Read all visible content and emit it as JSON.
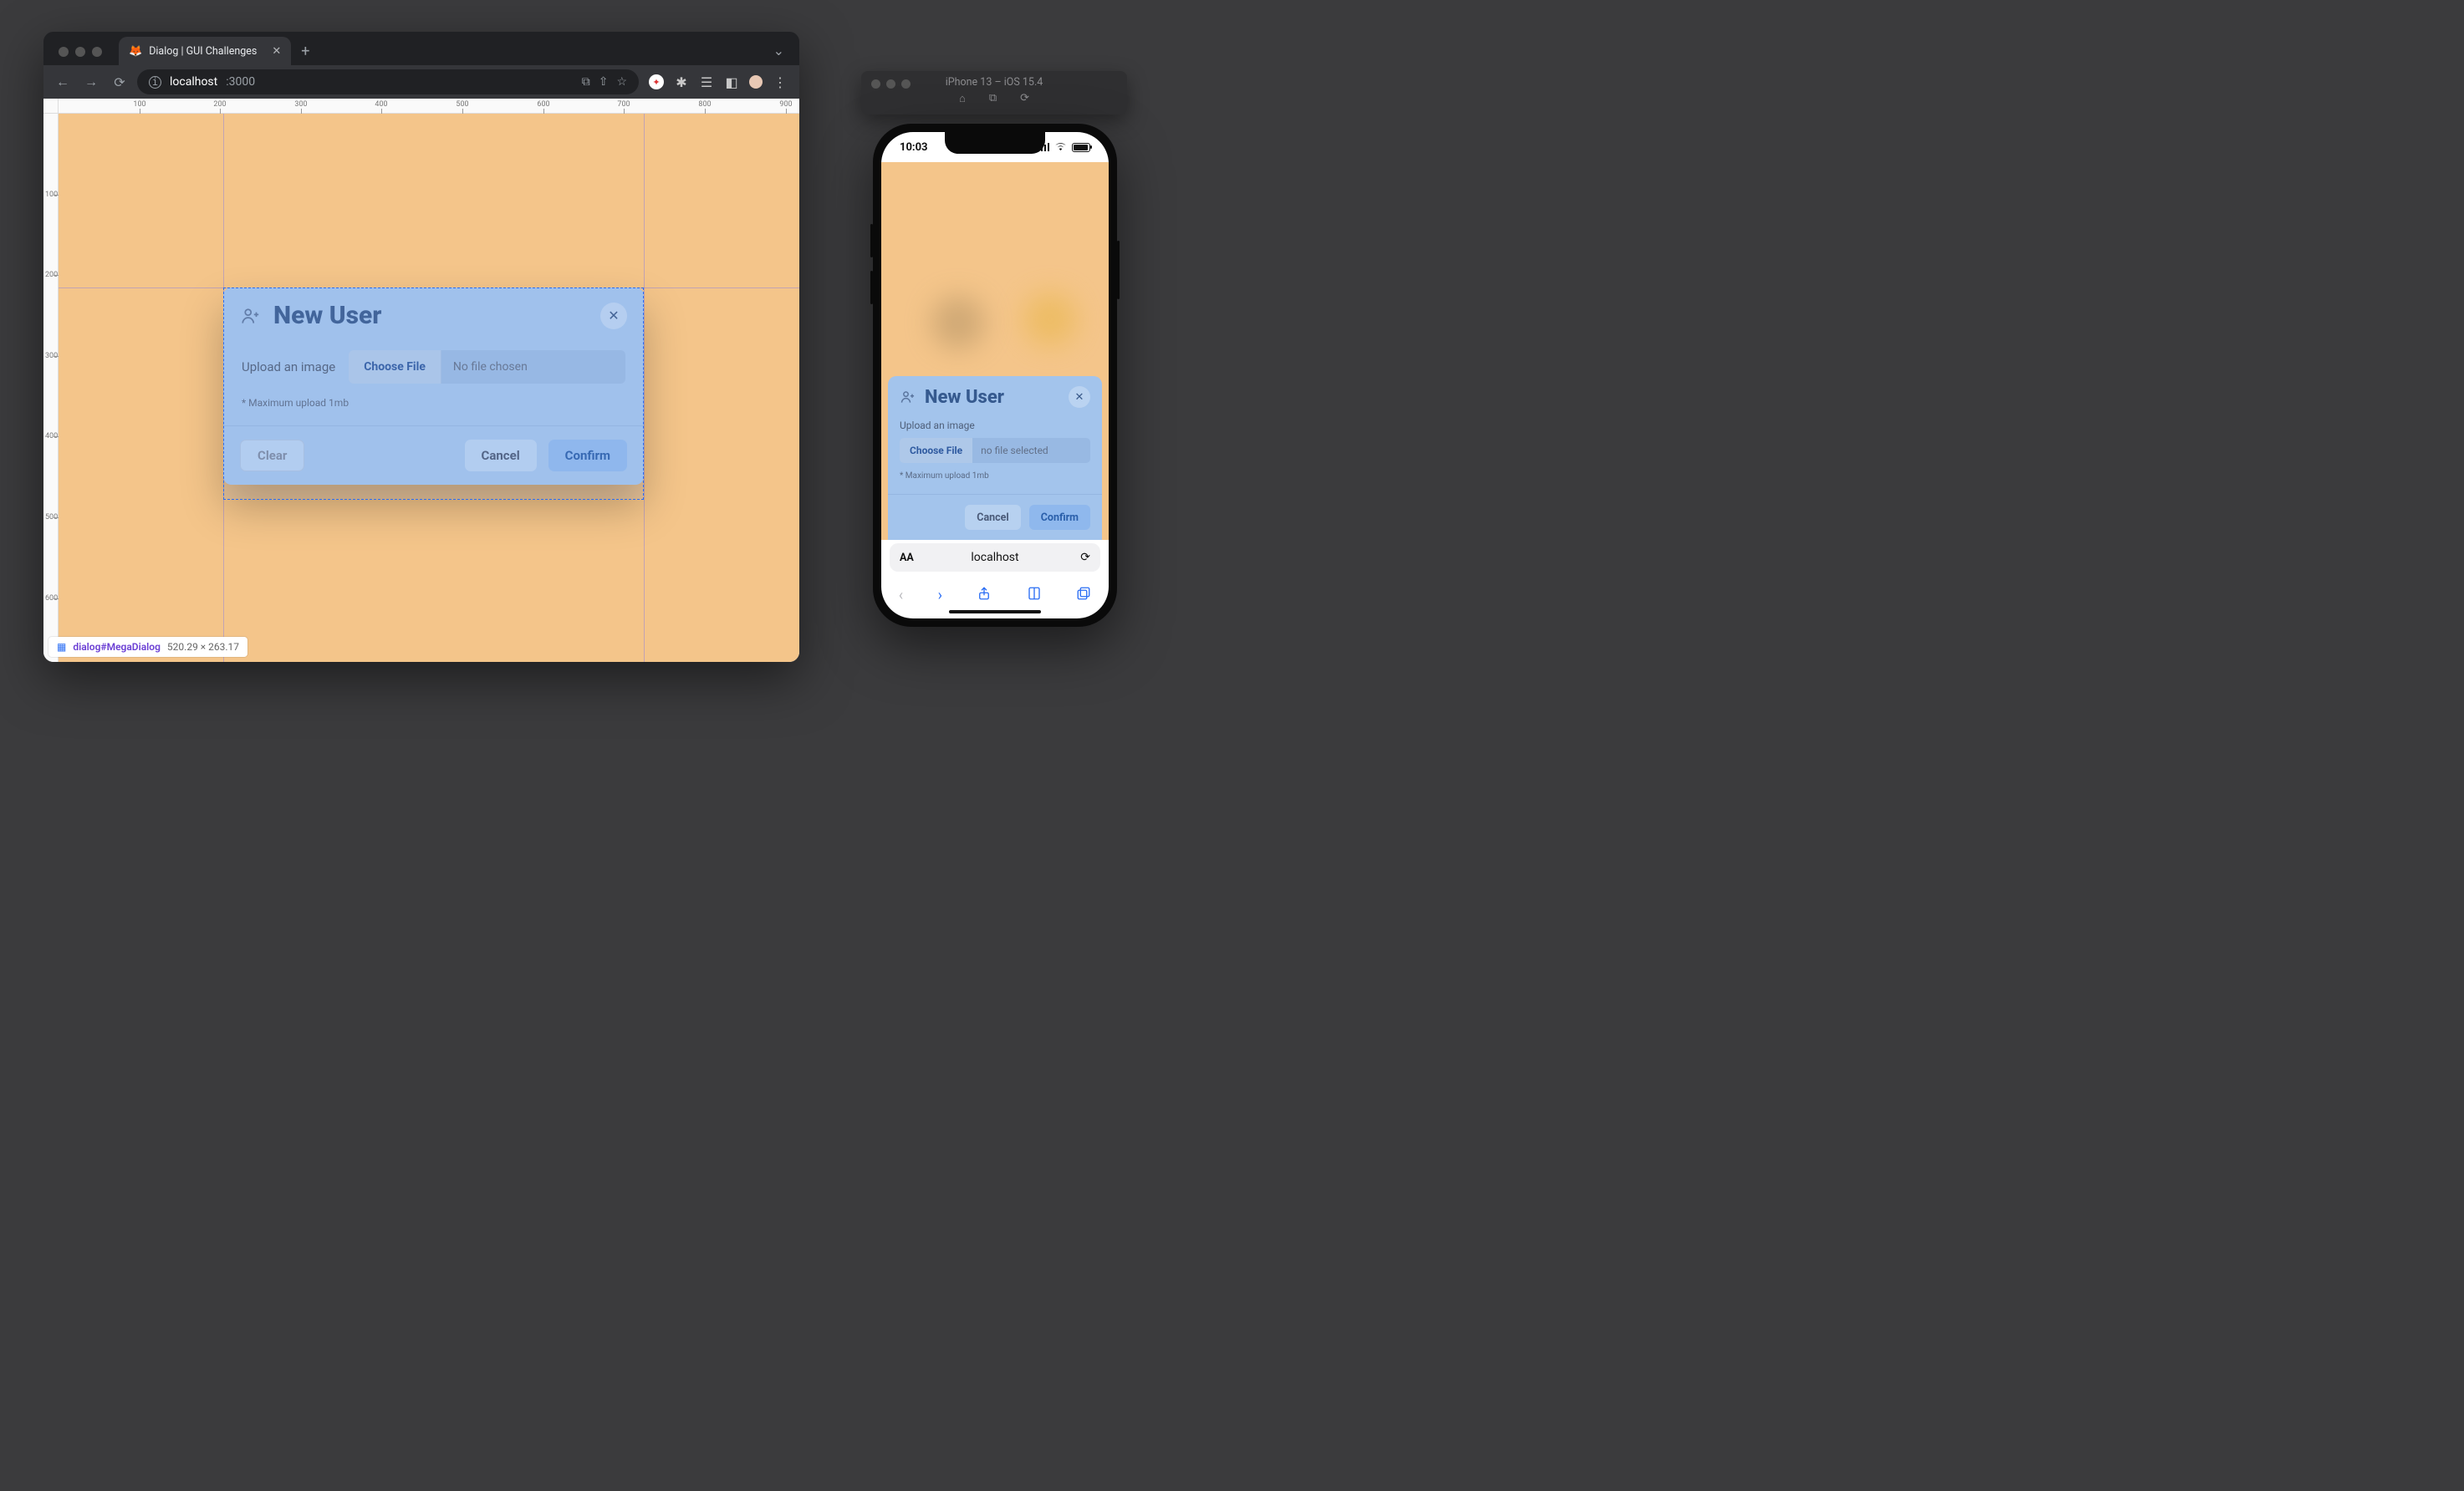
{
  "browser": {
    "tab_title": "Dialog | GUI Challenges",
    "url_host": "localhost",
    "url_port": ":3000",
    "ruler_h": [
      "100",
      "200",
      "300",
      "400",
      "500",
      "600",
      "700",
      "800",
      "900"
    ],
    "ruler_v": [
      "100",
      "200",
      "300",
      "400",
      "500",
      "600"
    ]
  },
  "devtools_badge": {
    "selector": "dialog#MegaDialog",
    "dims": "520.29 × 263.17"
  },
  "dialog": {
    "title": "New User",
    "upload_label": "Upload an image",
    "choose_file": "Choose File",
    "no_file": "No file chosen",
    "hint": "* Maximum upload 1mb",
    "clear": "Clear",
    "cancel": "Cancel",
    "confirm": "Confirm"
  },
  "simulator": {
    "title": "iPhone 13 – iOS 15.4",
    "clock": "10:03",
    "safari_host": "localhost"
  },
  "mobile_dialog": {
    "title": "New User",
    "upload_label": "Upload an image",
    "choose_file": "Choose File",
    "no_file": "no file selected",
    "hint": "* Maximum upload 1mb",
    "cancel": "Cancel",
    "confirm": "Confirm"
  }
}
